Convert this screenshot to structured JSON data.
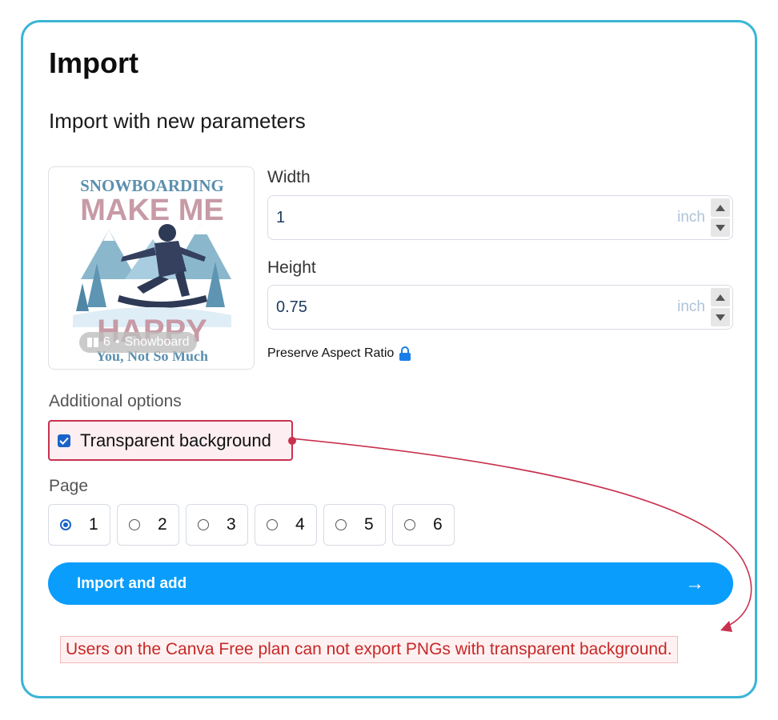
{
  "dialog": {
    "title": "Import",
    "subtitle": "Import with new parameters"
  },
  "preview": {
    "art_top_line": "SNOWBOARDING",
    "art_line_2": "MAKE ME",
    "art_line_3": "HAPPY",
    "art_line_4": "You, Not So Much",
    "badge_pages": "6",
    "badge_separator": "•",
    "badge_name": "Snowboard"
  },
  "width_field": {
    "label": "Width",
    "value": "1",
    "unit": "inch"
  },
  "height_field": {
    "label": "Height",
    "value": "0.75",
    "unit": "inch"
  },
  "aspect": {
    "label": "Preserve Aspect Ratio",
    "locked": true
  },
  "additional": {
    "label": "Additional options",
    "transparent_label": "Transparent background",
    "transparent_checked": true
  },
  "page": {
    "label": "Page",
    "options": [
      "1",
      "2",
      "3",
      "4",
      "5",
      "6"
    ],
    "selected": "1"
  },
  "import_button": {
    "label": "Import and add",
    "icon": "arrow-right-icon"
  },
  "warning": "Users on the Canva Free plan can not export PNGs with transparent background.",
  "colors": {
    "panel_border": "#3bb5d6",
    "primary": "#0a9dfb",
    "annotation": "#c8314f",
    "warning_text": "#c62828"
  }
}
